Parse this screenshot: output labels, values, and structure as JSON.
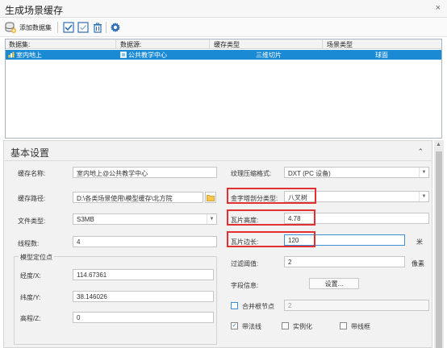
{
  "window": {
    "title": "生成场景缓存",
    "close_symbol": "×"
  },
  "toolbar": {
    "add_dataset_label": "添加数据集"
  },
  "table": {
    "headers": [
      "数据集:",
      "数据源:",
      "缓存类型",
      "场景类型"
    ],
    "rows": [
      {
        "dataset": "室内地上",
        "datasource": "公共教学中心",
        "cache_type": "三维切片",
        "scene_type": "球面"
      }
    ]
  },
  "settings": {
    "header": "基本设置",
    "collapse_symbol": "⌃",
    "cache_name_label": "缓存名称:",
    "cache_name_value": "室内地上@公共教学中心",
    "cache_path_label": "缓存路径:",
    "cache_path_value": "D:\\各类场景使用\\模型缓存\\北方院",
    "file_type_label": "文件类型:",
    "file_type_value": "S3MB",
    "threads_label": "线程数:",
    "threads_value": "4",
    "model_position_group": "模型定位点",
    "longitude_label": "经度/X:",
    "longitude_value": "114.67361",
    "latitude_label": "纬度/Y:",
    "latitude_value": "38.146026",
    "elevation_label": "高程/Z:",
    "elevation_value": "0",
    "texture_label": "纹理压缩格式:",
    "texture_value": "DXT (PC 设备)",
    "pyramid_label": "金字塔剖分类型:",
    "pyramid_value": "八叉树",
    "tile_height_label": "瓦片高度:",
    "tile_height_value": "4.78",
    "tile_side_label": "瓦片边长:",
    "tile_side_value": "120",
    "tile_side_unit": "米",
    "filter_label": "过滤阈值:",
    "filter_value": "2",
    "filter_unit": "像素",
    "field_info_label": "字段信息:",
    "settings_button": "设置...",
    "merge_nodes_label": "合并根节点",
    "merge_nodes_value": "2",
    "wireframe_label": "带法线",
    "instancing_label": "实例化",
    "border_label": "带线框"
  }
}
